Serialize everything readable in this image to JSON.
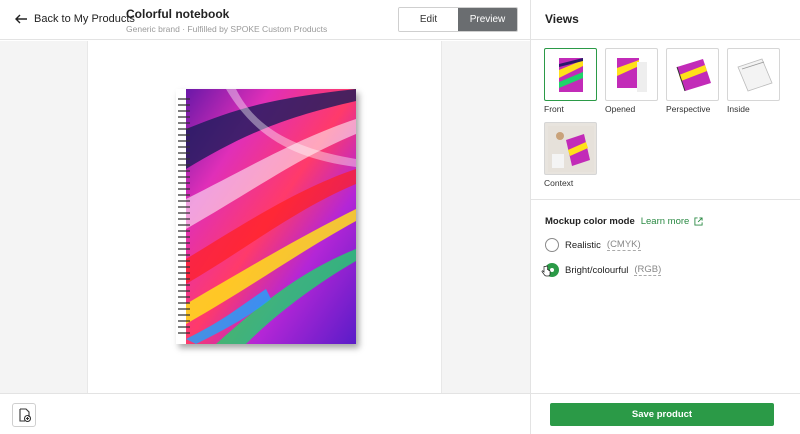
{
  "header": {
    "back_label": "Back to My Products",
    "title": "Colorful notebook",
    "subtitle": "Generic brand · Fulfilled by SPOKE Custom Products",
    "edit_label": "Edit",
    "preview_label": "Preview"
  },
  "panel": {
    "title": "Views",
    "views": [
      {
        "label": "Front",
        "icon": "notebook-front-thumb",
        "selected": true
      },
      {
        "label": "Opened",
        "icon": "notebook-opened-thumb",
        "selected": false
      },
      {
        "label": "Perspective",
        "icon": "notebook-perspective-thumb",
        "selected": false
      },
      {
        "label": "Inside",
        "icon": "notebook-inside-thumb",
        "selected": false
      },
      {
        "label": "Context",
        "icon": "notebook-context-thumb",
        "selected": false
      }
    ],
    "color_mode": {
      "title": "Mockup color mode",
      "learn_more": "Learn more",
      "options": [
        {
          "label": "Realistic",
          "hint": "(CMYK)",
          "checked": false
        },
        {
          "label": "Bright/colourful",
          "hint": "(RGB)",
          "checked": true
        }
      ]
    },
    "save_label": "Save product"
  },
  "colors": {
    "accent": "#2b9a47",
    "preview_active": "#6a6d70"
  }
}
